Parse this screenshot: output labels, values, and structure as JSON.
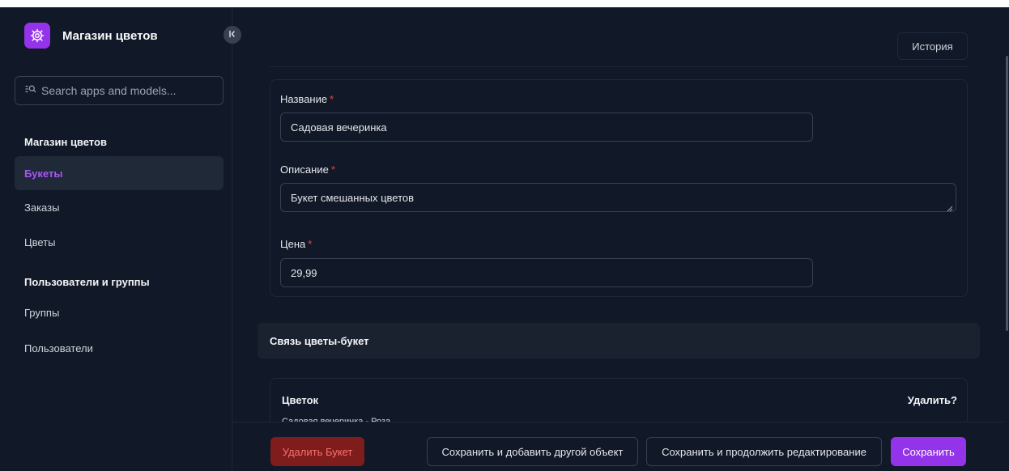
{
  "sidebar": {
    "brand_title": "Магазин цветов",
    "brand_icon": "gear-icon",
    "collapse_icon": "collapse-left-icon",
    "search_placeholder": "Search apps and models...",
    "sections": [
      {
        "title": "Магазин цветов",
        "items": [
          {
            "label": "Букеты",
            "active": true
          },
          {
            "label": "Заказы",
            "active": false
          },
          {
            "label": "Цветы",
            "active": false
          }
        ]
      },
      {
        "title": "Пользователи и группы",
        "items": [
          {
            "label": "Группы",
            "active": false
          },
          {
            "label": "Пользователи",
            "active": false
          }
        ]
      }
    ]
  },
  "header": {
    "history_label": "История"
  },
  "form": {
    "fields": [
      {
        "label": "Название",
        "required_mark": "*",
        "value": "Садовая вечеринка"
      },
      {
        "label": "Описание",
        "required_mark": "*",
        "value": "Букет смешанных цветов"
      },
      {
        "label": "Цена",
        "required_mark": "*",
        "value": "29,99"
      }
    ]
  },
  "inline": {
    "title": "Связь цветы-букет",
    "columns": [
      "Цветок",
      "Удалить?"
    ],
    "rows": [
      {
        "text": "Садовая вечеринка - Роза"
      }
    ]
  },
  "footer": {
    "delete_label": "Удалить Букет",
    "save_add_label": "Сохранить и добавить другой объект",
    "save_continue_label": "Сохранить и продолжить редактирование",
    "save_label": "Сохранить"
  },
  "colors": {
    "accent": "#9333ea",
    "background": "#111827",
    "danger": "#ef4444"
  }
}
